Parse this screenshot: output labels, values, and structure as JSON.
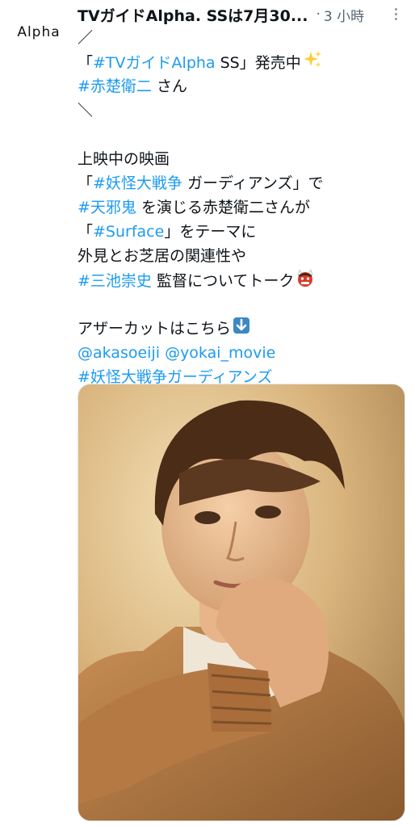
{
  "avatar": {
    "label": "Alpha"
  },
  "tweet": {
    "author": "TVガイドAlpha. SSは7月30...",
    "separator": "·",
    "time": "3 小時",
    "lines": {
      "l1": "／",
      "l2a": "「",
      "l2b": "#TVガイドAlpha",
      "l2c": " SS」発売中",
      "l3a": "#赤楚衛二",
      "l3b": " さん",
      "l4": "＼",
      "l6": "上映中の映画",
      "l7a": "「",
      "l7b": "#妖怪大戦争",
      "l7c": " ガーディアンズ」で",
      "l8a": "#天邪鬼",
      "l8b": " を演じる赤楚衛二さんが",
      "l9a": "「",
      "l9b": "#Surface",
      "l9c": "」をテーマに",
      "l10": "外見とお芝居の関連性や",
      "l11a": "#三池崇史",
      "l11b": " 監督についてトーク",
      "l13": "アザーカットはこちら",
      "l14a": "@akasoeiji",
      "l14b": " ",
      "l14c": "@yokai_movie",
      "l15": "#妖怪大戦争ガーディアンズ"
    },
    "emojis": [
      "sparkles-emoji",
      "ogre-emoji",
      "down-arrow-emoji"
    ]
  },
  "colors": {
    "link": "#1d9bf0",
    "text": "#0f1419",
    "muted": "#536471"
  }
}
